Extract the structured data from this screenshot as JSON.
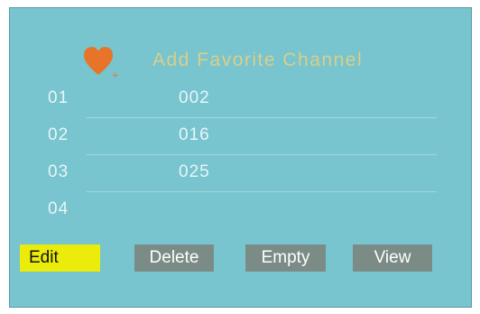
{
  "header": {
    "icon": "heart-icon",
    "title": "Add Favorite Channel"
  },
  "favorites": [
    {
      "slot": "01",
      "channel": "002"
    },
    {
      "slot": "02",
      "channel": "016"
    },
    {
      "slot": "03",
      "channel": "025"
    },
    {
      "slot": "04",
      "channel": ""
    }
  ],
  "buttons": {
    "edit": "Edit",
    "delete": "Delete",
    "empty": "Empty",
    "view": "View"
  },
  "colors": {
    "background": "#78c4cf",
    "heart": "#e8742a",
    "selected_button": "#ecec0a",
    "button": "#7b8c87"
  }
}
